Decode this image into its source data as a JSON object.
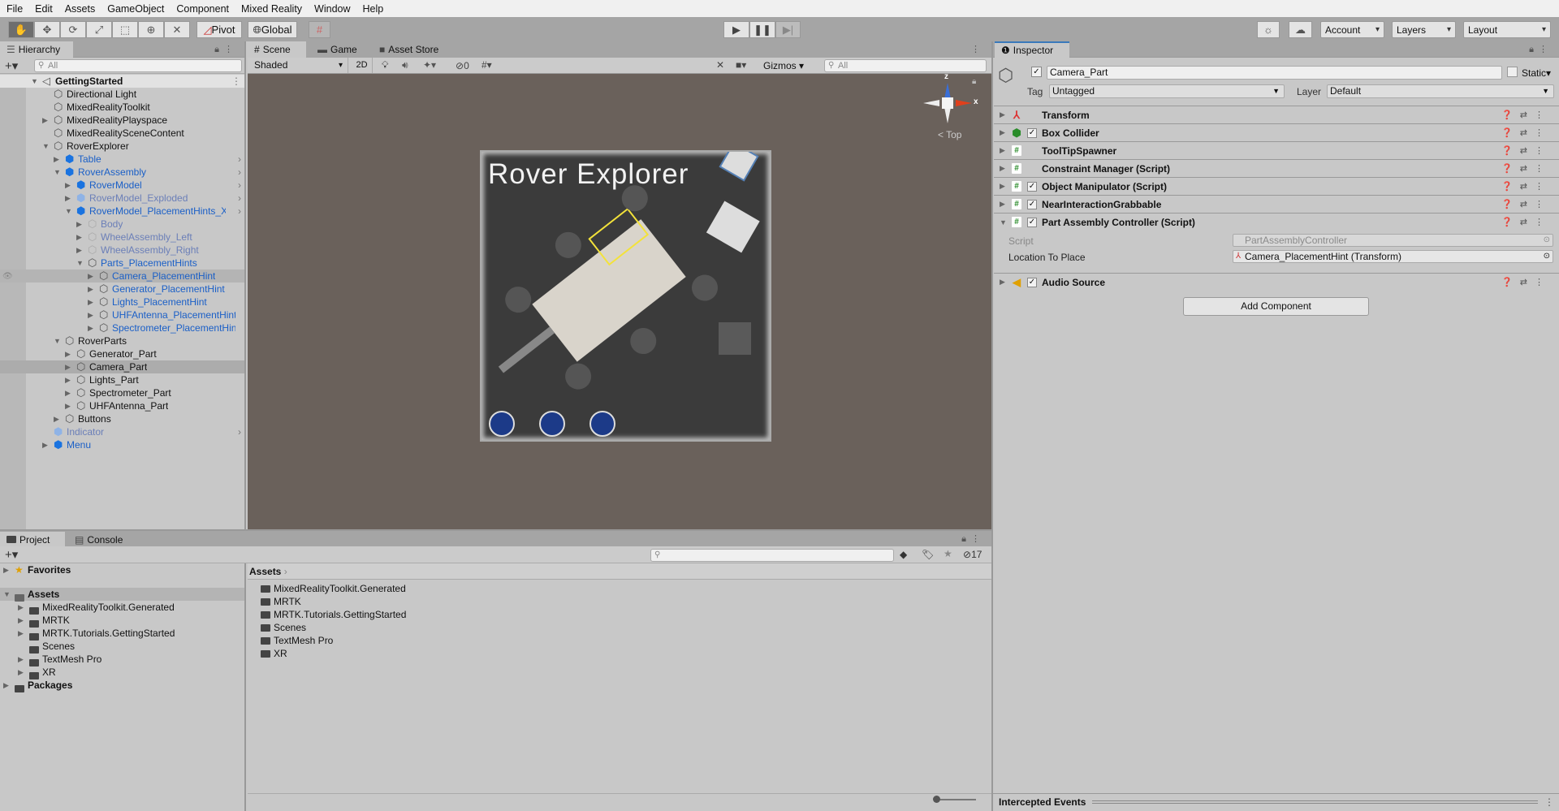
{
  "menu": [
    "File",
    "Edit",
    "Assets",
    "GameObject",
    "Component",
    "Mixed Reality",
    "Window",
    "Help"
  ],
  "toolbar": {
    "tools": [
      "hand-tool",
      "move-tool",
      "rotate-tool",
      "scale-tool",
      "rect-tool",
      "transform-tool",
      "custom-tool"
    ],
    "pivot_label": "Pivot",
    "global_label": "Global",
    "account_label": "Account",
    "layers_label": "Layers",
    "layout_label": "Layout"
  },
  "hierarchy": {
    "tab_label": "Hierarchy",
    "search_placeholder": "All",
    "items": [
      {
        "label": "GettingStarted",
        "level": 0,
        "arrow": "down",
        "kind": "scene"
      },
      {
        "label": "Directional Light",
        "level": 1,
        "arrow": "none",
        "kind": "normal"
      },
      {
        "label": "MixedRealityToolkit",
        "level": 1,
        "arrow": "none",
        "kind": "normal"
      },
      {
        "label": "MixedRealityPlayspace",
        "level": 1,
        "arrow": "right",
        "kind": "normal"
      },
      {
        "label": "MixedRealitySceneContent",
        "level": 1,
        "arrow": "none",
        "kind": "normal"
      },
      {
        "label": "RoverExplorer",
        "level": 1,
        "arrow": "down",
        "kind": "normal"
      },
      {
        "label": "Table",
        "level": 2,
        "arrow": "right",
        "kind": "prefab",
        "chevron": true
      },
      {
        "label": "RoverAssembly",
        "level": 2,
        "arrow": "down",
        "kind": "prefab",
        "chevron": true
      },
      {
        "label": "RoverModel",
        "level": 3,
        "arrow": "right",
        "kind": "prefab",
        "chevron": true
      },
      {
        "label": "RoverModel_Exploded",
        "level": 3,
        "arrow": "right",
        "kind": "prefab-faded",
        "chevron": true
      },
      {
        "label": "RoverModel_PlacementHints_XR",
        "level": 3,
        "arrow": "down",
        "kind": "prefab",
        "chevron": true
      },
      {
        "label": "Body",
        "level": 4,
        "arrow": "right",
        "kind": "faded"
      },
      {
        "label": "WheelAssembly_Left",
        "level": 4,
        "arrow": "right",
        "kind": "faded"
      },
      {
        "label": "WheelAssembly_Right",
        "level": 4,
        "arrow": "right",
        "kind": "faded"
      },
      {
        "label": "Parts_PlacementHints",
        "level": 4,
        "arrow": "down",
        "kind": "child"
      },
      {
        "label": "Camera_PlacementHint",
        "level": 5,
        "arrow": "right",
        "kind": "child",
        "hover": true
      },
      {
        "label": "Generator_PlacementHint",
        "level": 5,
        "arrow": "right",
        "kind": "child"
      },
      {
        "label": "Lights_PlacementHint",
        "level": 5,
        "arrow": "right",
        "kind": "child"
      },
      {
        "label": "UHFAntenna_PlacementHint",
        "level": 5,
        "arrow": "right",
        "kind": "child"
      },
      {
        "label": "Spectrometer_PlacementHint",
        "level": 5,
        "arrow": "right",
        "kind": "child"
      },
      {
        "label": "RoverParts",
        "level": 2,
        "arrow": "down",
        "kind": "normal"
      },
      {
        "label": "Generator_Part",
        "level": 3,
        "arrow": "right",
        "kind": "normal"
      },
      {
        "label": "Camera_Part",
        "level": 3,
        "arrow": "right",
        "kind": "normal",
        "selected": true
      },
      {
        "label": "Lights_Part",
        "level": 3,
        "arrow": "right",
        "kind": "normal"
      },
      {
        "label": "Spectrometer_Part",
        "level": 3,
        "arrow": "right",
        "kind": "normal"
      },
      {
        "label": "UHFAntenna_Part",
        "level": 3,
        "arrow": "right",
        "kind": "normal"
      },
      {
        "label": "Buttons",
        "level": 2,
        "arrow": "right",
        "kind": "normal"
      },
      {
        "label": "Indicator",
        "level": 1,
        "arrow": "none",
        "kind": "prefab-faded",
        "chevron": true
      },
      {
        "label": "Menu",
        "level": 1,
        "arrow": "right",
        "kind": "prefab"
      }
    ]
  },
  "scene": {
    "tabs": [
      "Scene",
      "Game",
      "Asset Store"
    ],
    "shading": "Shaded",
    "mode_2d": "2D",
    "hidden_count": "0",
    "gizmos_label": "Gizmos",
    "search_placeholder": "All",
    "view_label": "Top",
    "axis_x": "x",
    "axis_z": "z",
    "rover_title": "Rover Explorer"
  },
  "inspector": {
    "tab_label": "Inspector",
    "object_name": "Camera_Part",
    "static_label": "Static",
    "tag_label": "Tag",
    "tag_value": "Untagged",
    "layer_label": "Layer",
    "layer_value": "Default",
    "components": [
      {
        "name": "Transform",
        "icon": "transform",
        "checkbox": false,
        "expanded": false
      },
      {
        "name": "Box Collider",
        "icon": "box-collider",
        "checkbox": true,
        "expanded": false
      },
      {
        "name": "ToolTipSpawner",
        "icon": "script",
        "checkbox": false,
        "expanded": false
      },
      {
        "name": "Constraint Manager (Script)",
        "icon": "script",
        "checkbox": false,
        "expanded": false
      },
      {
        "name": "Object Manipulator (Script)",
        "icon": "script",
        "checkbox": true,
        "expanded": false
      },
      {
        "name": "NearInteractionGrabbable",
        "icon": "script",
        "checkbox": true,
        "expanded": false
      },
      {
        "name": "Part Assembly Controller (Script)",
        "icon": "script",
        "checkbox": true,
        "expanded": true
      },
      {
        "name": "Audio Source",
        "icon": "audio",
        "checkbox": true,
        "expanded": false
      }
    ],
    "script_label": "Script",
    "script_value": "PartAssemblyController",
    "location_label": "Location To Place",
    "location_value": "Camera_PlacementHint (Transform)",
    "add_component": "Add Component",
    "intercepted_events": "Intercepted Events"
  },
  "project": {
    "tabs": [
      "Project",
      "Console"
    ],
    "hidden_count": "17",
    "tree": [
      {
        "label": "Favorites",
        "level": 0,
        "arrow": "right",
        "bold": true,
        "icon": "star"
      },
      {
        "label": "Assets",
        "level": 0,
        "arrow": "down",
        "bold": true,
        "icon": "folder-open",
        "selected": true
      },
      {
        "label": "MixedRealityToolkit.Generated",
        "level": 1,
        "arrow": "right"
      },
      {
        "label": "MRTK",
        "level": 1,
        "arrow": "right"
      },
      {
        "label": "MRTK.Tutorials.GettingStarted",
        "level": 1,
        "arrow": "right"
      },
      {
        "label": "Scenes",
        "level": 1,
        "arrow": "none"
      },
      {
        "label": "TextMesh Pro",
        "level": 1,
        "arrow": "right"
      },
      {
        "label": "XR",
        "level": 1,
        "arrow": "right"
      },
      {
        "label": "Packages",
        "level": 0,
        "arrow": "right",
        "bold": true
      }
    ],
    "breadcrumb": "Assets",
    "files": [
      "MixedRealityToolkit.Generated",
      "MRTK",
      "MRTK.Tutorials.GettingStarted",
      "Scenes",
      "TextMesh Pro",
      "XR"
    ]
  },
  "colors": {
    "prefab": "#1a5fc7",
    "faded": "#6b7fb8",
    "accent": "#3a79bb",
    "scene_bg": "#6a615b"
  }
}
